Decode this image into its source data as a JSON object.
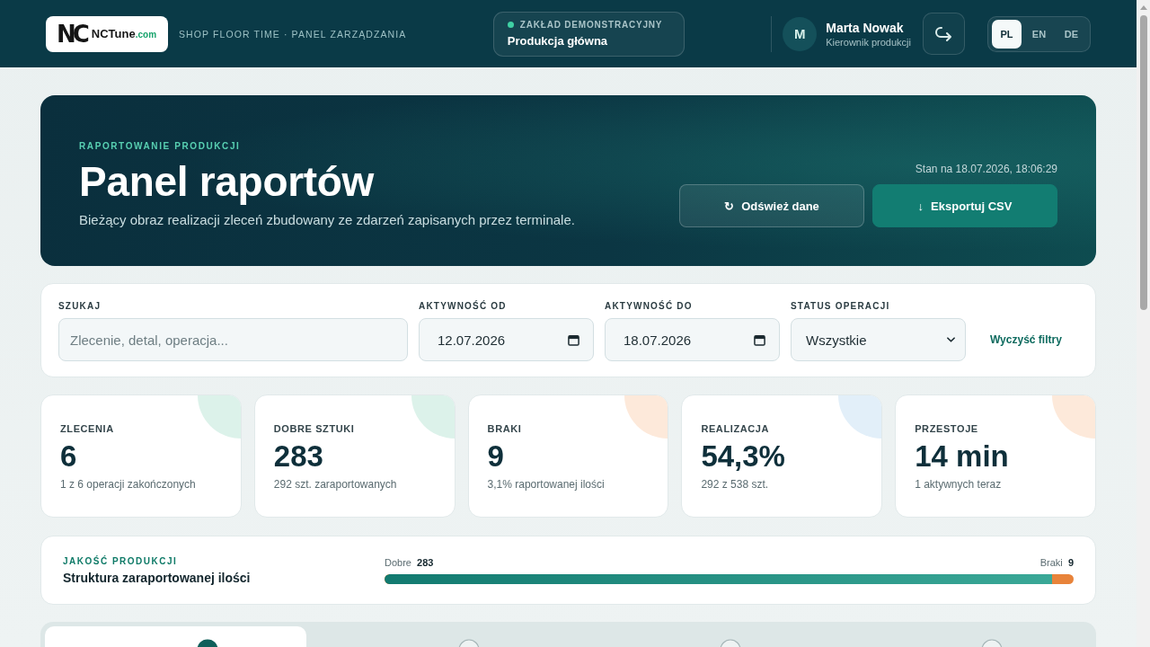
{
  "header": {
    "logo": {
      "mark": "NC",
      "name": "NCTune",
      "domain": ".com"
    },
    "tagline": "SHOP FLOOR TIME · PANEL ZARZĄDZANIA",
    "plant": {
      "label": "ZAKŁAD DEMONSTRACYJNY",
      "name": "Produkcja główna"
    },
    "user": {
      "initial": "M",
      "name": "Marta Nowak",
      "role": "Kierownik produkcji"
    },
    "languages": [
      {
        "label": "PL",
        "selected": true
      },
      {
        "label": "EN",
        "selected": false
      },
      {
        "label": "DE",
        "selected": false
      }
    ]
  },
  "hero": {
    "eyebrow": "RAPORTOWANIE PRODUKCJI",
    "title": "Panel raportów",
    "subtitle": "Bieżący obraz realizacji zleceń zbudowany ze zdarzeń zapisanych przez terminale.",
    "timestamp": "Stan na 18.07.2026, 18:06:29",
    "buttons": [
      {
        "kind": "secondary",
        "glyph": "↻",
        "label": "Odśwież dane"
      },
      {
        "kind": "primary",
        "glyph": "↓",
        "label": "Eksportuj CSV"
      }
    ]
  },
  "filters": {
    "fields": [
      {
        "kind": "search",
        "label": "SZUKAJ",
        "placeholder": "Zlecenie, detal, operacja..."
      },
      {
        "kind": "date",
        "label": "AKTYWNOŚĆ OD",
        "value": "12.07.2026"
      },
      {
        "kind": "date",
        "label": "AKTYWNOŚĆ DO",
        "value": "18.07.2026"
      },
      {
        "kind": "select",
        "label": "STATUS OPERACJI",
        "value": "Wszystkie"
      }
    ],
    "clear": "Wyczyść filtry"
  },
  "stats": [
    {
      "label": "ZLECENIA",
      "value": "6",
      "note": "1 z 6 operacji zakończonych",
      "color": "#dcf2ea"
    },
    {
      "label": "DOBRE SZTUKI",
      "value": "283",
      "note": "292 szt. zaraportowanych",
      "color": "#dcf2ea"
    },
    {
      "label": "BRAKI",
      "value": "9",
      "note": "3,1% raportowanej ilości",
      "color": "#fde9da"
    },
    {
      "label": "REALIZACJA",
      "value": "54,3%",
      "note": "292 z 538 szt.",
      "color": "#e2eff9"
    },
    {
      "label": "PRZESTOJE",
      "value": "14 min",
      "note": "1 aktywnych teraz",
      "color": "#fde9da"
    }
  ],
  "quality": {
    "eyebrow": "JAKOŚĆ PRODUKCJI",
    "title": "Struktura zaraportowanej ilości",
    "good_label": "Dobre",
    "good_value": "283",
    "bad_label": "Braki",
    "bad_value": "9",
    "level": 0.969
  },
  "tabs": [
    {
      "selected": true
    },
    {
      "selected": false
    },
    {
      "selected": false
    },
    {
      "selected": false
    }
  ]
}
